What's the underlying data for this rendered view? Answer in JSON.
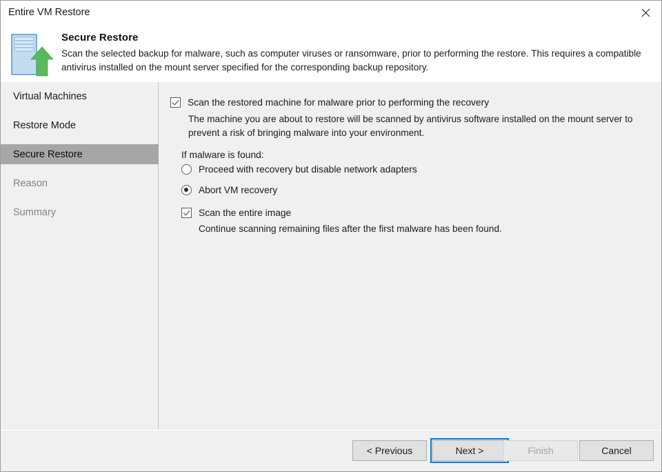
{
  "window": {
    "title": "Entire VM Restore",
    "close_icon": "close-icon"
  },
  "header": {
    "icon": "restore-vm-icon",
    "title": "Secure Restore",
    "description": "Scan the selected backup for malware, such as computer viruses or ransomware, prior to performing the restore. This requires a compatible antivirus installed on the mount server specified for the corresponding backup repository."
  },
  "sidebar": {
    "items": [
      {
        "label": "Virtual Machines",
        "state": "normal"
      },
      {
        "label": "Restore Mode",
        "state": "normal"
      },
      {
        "label": "Secure Restore",
        "state": "selected"
      },
      {
        "label": "Reason",
        "state": "disabled"
      },
      {
        "label": "Summary",
        "state": "disabled"
      }
    ]
  },
  "main": {
    "scan_checkbox": {
      "label": "Scan the restored machine for malware prior to performing the recovery",
      "checked": true
    },
    "scan_description": "The machine you are about to restore will be scanned by antivirus software installed on the mount server to prevent a risk of bringing malware into your environment.",
    "malware_group_label": "If malware is found:",
    "malware_options": [
      {
        "label": "Proceed with recovery but disable network adapters",
        "selected": false
      },
      {
        "label": "Abort VM recovery",
        "selected": true
      }
    ],
    "entire_image_checkbox": {
      "label": "Scan the entire image",
      "checked": true
    },
    "entire_image_description": "Continue scanning remaining files after the first malware has been found."
  },
  "footer": {
    "previous_label": "< Previous",
    "next_label": "Next >",
    "finish_label": "Finish",
    "cancel_label": "Cancel"
  },
  "colors": {
    "accent": "#0078d7",
    "selection": "#a6a6a6",
    "arrow_green": "#5cb85c",
    "dialog_bg": "#f0f0f0"
  }
}
